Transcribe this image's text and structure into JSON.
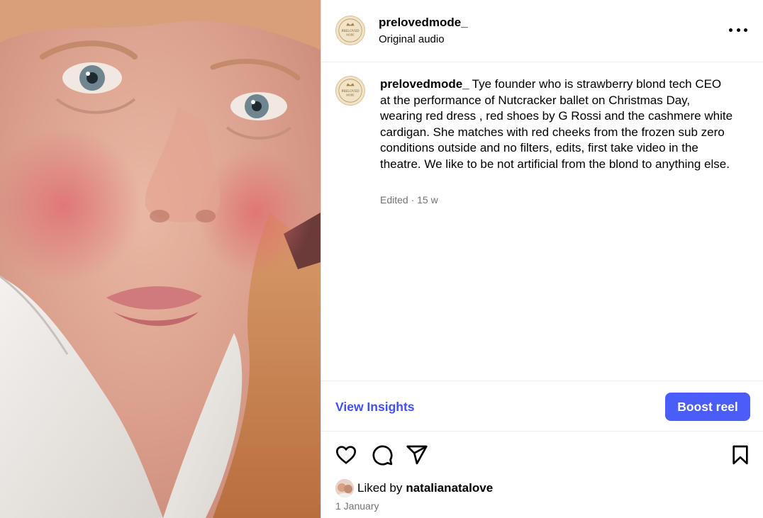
{
  "post": {
    "username": "prelovedmode_",
    "audio": "Original audio",
    "avatar_text": "PRELOVED MODE"
  },
  "caption": {
    "username": "prelovedmode_",
    "text": "Tye founder who is strawberry blond tech CEO at the performance of Nutcracker ballet on Christmas Day, wearing red dress , red shoes by G Rossi and the cashmere white cardigan. She matches with red cheeks from the frozen sub zero conditions outside and no filters, edits, first take video in the theatre. We like to be not artificial from the blond to anything else.",
    "meta": "Edited · 15 w"
  },
  "insights": {
    "view_label": "View Insights",
    "boost_label": "Boost reel"
  },
  "icons": {
    "like": "heart-icon",
    "comment": "comment-icon",
    "share": "share-icon",
    "save": "bookmark-icon",
    "more": "more-icon"
  },
  "likes": {
    "prefix": "Liked by",
    "user": "natalianatalove"
  },
  "date": "1 January",
  "colors": {
    "accent": "#4a5df9",
    "link": "#4150f7",
    "muted": "#737373"
  }
}
